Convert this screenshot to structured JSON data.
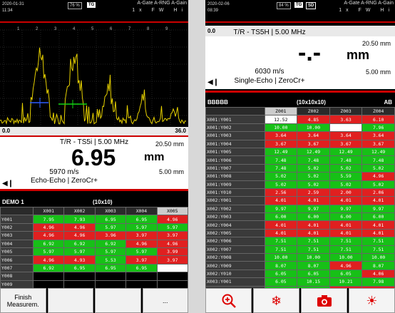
{
  "left": {
    "status": {
      "date": "2020-01-31",
      "time": "11:34",
      "battery": "76 %",
      "tag": "TG",
      "gates": "A-Gate A-RNG A-Gain",
      "gate_vals": "1x FW Hi"
    },
    "range": {
      "start": "0.0",
      "end": "36.0"
    },
    "ascan_ticks": [
      "1",
      "2",
      "3",
      "4",
      "5",
      "6",
      "7",
      "8",
      "9"
    ],
    "probe": "T/R - TS5i | 5.00 MHz",
    "reading": "6.95",
    "unit": "mm",
    "velocity": "5970 m/s",
    "mode": "Echo-Echo | ZeroCr+",
    "side_top": "20.50 mm",
    "side_bottom": "5.00 mm",
    "grid": {
      "name": "DEMO 1",
      "size": "(10x10)",
      "cols": [
        "X001",
        "X002",
        "X003",
        "X004",
        "X005"
      ],
      "rows": [
        {
          "label": "Y001",
          "cells": [
            [
              "7.95",
              "g"
            ],
            [
              "7.93",
              "g"
            ],
            [
              "6.95",
              "g"
            ],
            [
              "6.95",
              "g"
            ],
            [
              "4.96",
              "r"
            ]
          ]
        },
        {
          "label": "Y002",
          "cells": [
            [
              "4.96",
              "r"
            ],
            [
              "4.96",
              "r"
            ],
            [
              "5.97",
              "g"
            ],
            [
              "5.97",
              "g"
            ],
            [
              "5.97",
              "g"
            ]
          ]
        },
        {
          "label": "Y003",
          "cells": [
            [
              "4.96",
              "r"
            ],
            [
              "4.96",
              "r"
            ],
            [
              "3.96",
              "r"
            ],
            [
              "3.97",
              "r"
            ],
            [
              "3.97",
              "r"
            ]
          ]
        },
        {
          "label": "Y004",
          "cells": [
            [
              "6.92",
              "g"
            ],
            [
              "6.92",
              "g"
            ],
            [
              "6.92",
              "g"
            ],
            [
              "4.96",
              "r"
            ],
            [
              "4.96",
              "r"
            ]
          ]
        },
        {
          "label": "Y005",
          "cells": [
            [
              "5.97",
              "g"
            ],
            [
              "5.97",
              "g"
            ],
            [
              "5.97",
              "g"
            ],
            [
              "5.97",
              "g"
            ],
            [
              "3.99",
              "r"
            ]
          ]
        },
        {
          "label": "Y006",
          "cells": [
            [
              "4.96",
              "r"
            ],
            [
              "4.93",
              "r"
            ],
            [
              "5.53",
              "g"
            ],
            [
              "3.97",
              "r"
            ],
            [
              "3.97",
              "r"
            ]
          ]
        },
        {
          "label": "Y007",
          "cells": [
            [
              "6.92",
              "g"
            ],
            [
              "6.95",
              "g"
            ],
            [
              "6.95",
              "g"
            ],
            [
              "6.95",
              "g"
            ],
            [
              "",
              "w"
            ]
          ]
        },
        {
          "label": "Y008",
          "cells": [
            [
              "",
              "k"
            ],
            [
              "",
              "k"
            ],
            [
              "",
              "k"
            ],
            [
              "",
              "k"
            ],
            [
              "",
              "k"
            ]
          ]
        },
        {
          "label": "Y009",
          "cells": [
            [
              "",
              "k"
            ],
            [
              "",
              "k"
            ],
            [
              "",
              "k"
            ],
            [
              "",
              "k"
            ],
            [
              "",
              "k"
            ]
          ]
        }
      ]
    },
    "softkeys": [
      "Finish Measurem.",
      "",
      "",
      "..."
    ]
  },
  "right": {
    "status": {
      "date": "2020-02-06",
      "time": "08:39",
      "battery": "84 %",
      "tag": "TG",
      "sd": "SD",
      "gates": "A-Gate A-RNG A-Gain",
      "gate_vals": "1x FW Hi"
    },
    "range": {
      "start": "0.0"
    },
    "probe": "T/R - TS5H | 5.00 MHz",
    "reading": "-.-",
    "unit": "mm",
    "velocity": "6030 m/s",
    "mode": "Single-Echo | ZeroCr+",
    "side_top": "20.50 mm",
    "side_bottom": "5.00 mm",
    "grid": {
      "name": "BBBBB",
      "size": "(10x10x10)",
      "corner": "AB",
      "cols": [
        "Z001",
        "Z002",
        "Z003",
        "Z004"
      ],
      "rows": [
        {
          "label": "X001:Y001",
          "cells": [
            [
              "12.52",
              "w"
            ],
            [
              "4.85",
              "r"
            ],
            [
              "3.63",
              "r"
            ],
            [
              "6.10",
              "r"
            ]
          ]
        },
        {
          "label": "X001:Y002",
          "cells": [
            [
              "10.00",
              "g"
            ],
            [
              "10.00",
              "g"
            ],
            [
              "",
              "xs"
            ],
            [
              "7.96",
              "g"
            ]
          ]
        },
        {
          "label": "X001:Y003",
          "cells": [
            [
              "3.64",
              "r"
            ],
            [
              "3.64",
              "r"
            ],
            [
              "3.64",
              "r"
            ],
            [
              "3.64",
              "r"
            ]
          ]
        },
        {
          "label": "X001:Y004",
          "cells": [
            [
              "3.67",
              "r"
            ],
            [
              "3.67",
              "r"
            ],
            [
              "3.67",
              "r"
            ],
            [
              "3.67",
              "r"
            ]
          ]
        },
        {
          "label": "X001:Y005",
          "cells": [
            [
              "12.49",
              "g"
            ],
            [
              "12.49",
              "g"
            ],
            [
              "12.49",
              "g"
            ],
            [
              "12.49",
              "g"
            ]
          ]
        },
        {
          "label": "X001:Y006",
          "cells": [
            [
              "7.48",
              "g"
            ],
            [
              "7.48",
              "g"
            ],
            [
              "7.48",
              "g"
            ],
            [
              "7.48",
              "g"
            ]
          ]
        },
        {
          "label": "X001:Y007",
          "cells": [
            [
              "7.48",
              "g"
            ],
            [
              "5.02",
              "g"
            ],
            [
              "5.02",
              "g"
            ],
            [
              "5.02",
              "g"
            ]
          ]
        },
        {
          "label": "X001:Y008",
          "cells": [
            [
              "5.02",
              "g"
            ],
            [
              "5.02",
              "g"
            ],
            [
              "5.59",
              "g"
            ],
            [
              "4.96",
              "r"
            ]
          ]
        },
        {
          "label": "X001:Y009",
          "cells": [
            [
              "5.02",
              "g"
            ],
            [
              "5.02",
              "g"
            ],
            [
              "5.02",
              "g"
            ],
            [
              "5.02",
              "g"
            ]
          ]
        },
        {
          "label": "X001:Y010",
          "cells": [
            [
              "2.56",
              "r"
            ],
            [
              "2.59",
              "r"
            ],
            [
              "2.00",
              "r"
            ],
            [
              "2.06",
              "r"
            ]
          ]
        },
        {
          "label": "X002:Y001",
          "cells": [
            [
              "4.01",
              "r"
            ],
            [
              "4.01",
              "r"
            ],
            [
              "4.01",
              "r"
            ],
            [
              "4.01",
              "r"
            ]
          ]
        },
        {
          "label": "X002:Y002",
          "cells": [
            [
              "9.97",
              "g"
            ],
            [
              "9.97",
              "g"
            ],
            [
              "9.97",
              "g"
            ],
            [
              "9.97",
              "g"
            ]
          ]
        },
        {
          "label": "X002:Y003",
          "cells": [
            [
              "6.00",
              "g"
            ],
            [
              "6.00",
              "g"
            ],
            [
              "6.00",
              "g"
            ],
            [
              "6.00",
              "g"
            ]
          ]
        },
        {
          "label": "X002:Y004",
          "cells": [
            [
              "4.01",
              "r"
            ],
            [
              "4.01",
              "r"
            ],
            [
              "4.01",
              "r"
            ],
            [
              "4.01",
              "r"
            ]
          ]
        },
        {
          "label": "X002:Y005",
          "cells": [
            [
              "4.01",
              "r"
            ],
            [
              "4.01",
              "r"
            ],
            [
              "4.01",
              "r"
            ],
            [
              "4.01",
              "r"
            ]
          ]
        },
        {
          "label": "X002:Y006",
          "cells": [
            [
              "7.51",
              "g"
            ],
            [
              "7.51",
              "g"
            ],
            [
              "7.51",
              "g"
            ],
            [
              "7.51",
              "g"
            ]
          ]
        },
        {
          "label": "X002:Y007",
          "cells": [
            [
              "7.51",
              "g"
            ],
            [
              "7.51",
              "g"
            ],
            [
              "7.51",
              "g"
            ],
            [
              "7.51",
              "g"
            ]
          ]
        },
        {
          "label": "X002:Y008",
          "cells": [
            [
              "10.00",
              "g"
            ],
            [
              "10.00",
              "g"
            ],
            [
              "10.00",
              "g"
            ],
            [
              "10.00",
              "g"
            ]
          ]
        },
        {
          "label": "X002:Y009",
          "cells": [
            [
              "8.07",
              "g"
            ],
            [
              "8.07",
              "g"
            ],
            [
              "4.96",
              "r"
            ],
            [
              "8.07",
              "g"
            ]
          ]
        },
        {
          "label": "X002:Y010",
          "cells": [
            [
              "6.05",
              "g"
            ],
            [
              "6.05",
              "g"
            ],
            [
              "6.05",
              "g"
            ],
            [
              "4.06",
              "r"
            ]
          ]
        },
        {
          "label": "X003:Y001",
          "cells": [
            [
              "6.05",
              "g"
            ],
            [
              "10.15",
              "g"
            ],
            [
              "10.21",
              "g"
            ],
            [
              "7.98",
              "g"
            ]
          ]
        },
        {
          "label": "X003:Y002",
          "cells": [
            [
              "6.02",
              "g"
            ],
            [
              "6.02",
              "g"
            ],
            [
              "4.96",
              "r"
            ],
            [
              "4.96",
              "r"
            ]
          ]
        }
      ]
    },
    "softkeys": [
      "zoom-in-icon",
      "freeze-icon",
      "snapshot-icon",
      "brightness-icon"
    ]
  },
  "colors": {
    "green": "#17c017",
    "red": "#e02020",
    "accent": "#cc0000"
  }
}
